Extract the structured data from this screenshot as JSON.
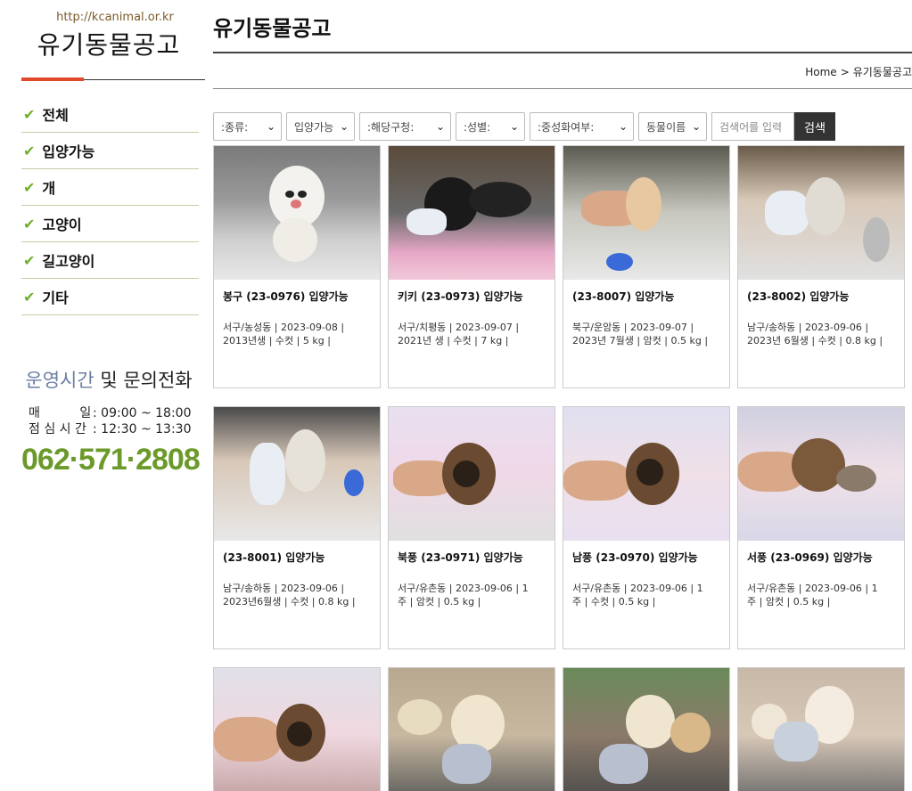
{
  "sidebar": {
    "site_url": "http://kcanimal.or.kr",
    "title": "유기동물공고",
    "menu": [
      "전체",
      "입양가능",
      "개",
      "고양이",
      "길고양이",
      "기타"
    ],
    "hours_title_a": "운영시간",
    "hours_title_b": " 및 문의전화",
    "hours": [
      {
        "k": "매          일",
        "v": ": 09:00 ~ 18:00"
      },
      {
        "k": "점 심 시 간",
        "v": ": 12:30 ~ 13:30"
      }
    ],
    "phone": "062·571·2808"
  },
  "main": {
    "title": "유기동물공고",
    "breadcrumb": [
      "Home",
      "유기동물공고"
    ],
    "filters": [
      ":종류:",
      "입양가능",
      ":해당구청:",
      ":성별:",
      ":중성화여부:",
      "동물이름"
    ],
    "search_placeholder": "검색어를 입력",
    "search_button": "검색"
  },
  "cards": [
    {
      "title": "봉구 (23-0976) 입양가능",
      "meta1": "서구/농성동 | 2023-09-08 |",
      "meta2": "2013년생 | 수컷 | 5 kg |"
    },
    {
      "title": "키키 (23-0973) 입양가능",
      "meta1": "서구/치평동 | 2023-09-07 |",
      "meta2": "2021년 생 | 수컷 | 7 kg |"
    },
    {
      "title": "(23-8007) 입양가능",
      "meta1": "북구/운암동 | 2023-09-07 |",
      "meta2": "2023년 7월생 | 암컷 | 0.5 kg |"
    },
    {
      "title": "(23-8002) 입양가능",
      "meta1": "남구/송하동 | 2023-09-06 |",
      "meta2": "2023년 6월생 | 수컷 | 0.8 kg |"
    },
    {
      "title": "(23-8001) 입양가능",
      "meta1": "남구/송하동 | 2023-09-06 |",
      "meta2": "2023년6월생 | 수컷 | 0.8 kg |"
    },
    {
      "title": "북풍 (23-0971) 입양가능",
      "meta1": "서구/유촌동 | 2023-09-06 | 1",
      "meta2": "주 | 암컷 | 0.5 kg |"
    },
    {
      "title": "남풍 (23-0970) 입양가능",
      "meta1": "서구/유촌동 | 2023-09-06 | 1",
      "meta2": "주 | 수컷 | 0.5 kg |"
    },
    {
      "title": "서풍 (23-0969) 입양가능",
      "meta1": "서구/유촌동 | 2023-09-06 | 1",
      "meta2": "주 | 암컷 | 0.5 kg |"
    }
  ]
}
